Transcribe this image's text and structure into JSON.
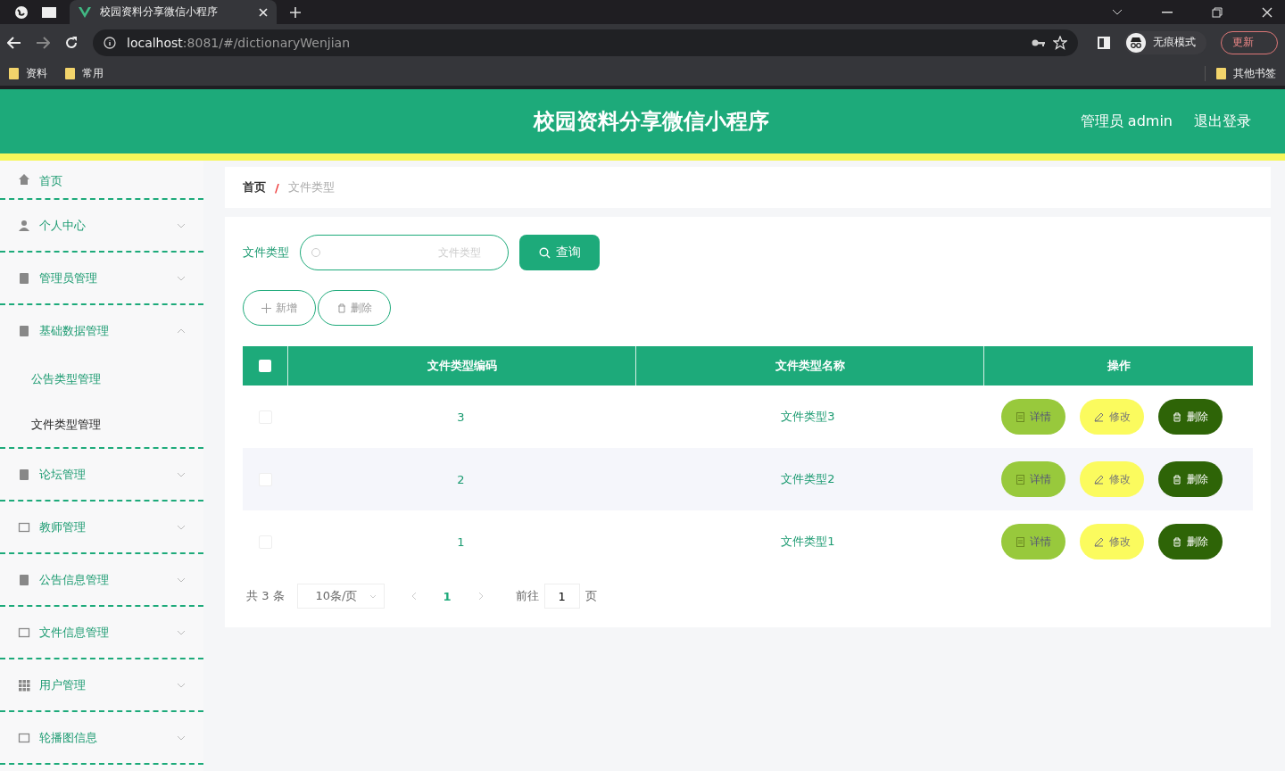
{
  "browser": {
    "tab_title": "校园资料分享微信小程序",
    "address_host": "localhost",
    "address_rest": ":8081/#/dictionaryWenjian",
    "incognito_label": "无痕模式",
    "update_label": "更新",
    "bookmarks": [
      "资料",
      "常用"
    ],
    "other_bookmarks": "其他书签"
  },
  "header": {
    "title": "校园资料分享微信小程序",
    "user": "管理员 admin",
    "logout": "退出登录"
  },
  "sidebar": {
    "items": [
      {
        "label": "首页",
        "has_arrow": false
      },
      {
        "label": "个人中心",
        "has_arrow": true,
        "expanded": false
      },
      {
        "label": "管理员管理",
        "has_arrow": true,
        "expanded": false
      },
      {
        "label": "基础数据管理",
        "has_arrow": true,
        "expanded": true,
        "children": [
          {
            "label": "公告类型管理",
            "selected": false
          },
          {
            "label": "文件类型管理",
            "selected": true
          }
        ]
      },
      {
        "label": "论坛管理",
        "has_arrow": true,
        "expanded": false
      },
      {
        "label": "教师管理",
        "has_arrow": true,
        "expanded": false
      },
      {
        "label": "公告信息管理",
        "has_arrow": true,
        "expanded": false
      },
      {
        "label": "文件信息管理",
        "has_arrow": true,
        "expanded": false
      },
      {
        "label": "用户管理",
        "has_arrow": true,
        "expanded": false
      },
      {
        "label": "轮播图信息",
        "has_arrow": true,
        "expanded": false
      }
    ]
  },
  "breadcrumb": [
    "首页",
    "文件类型"
  ],
  "breadcrumb_separator": "/",
  "search": {
    "label": "文件类型",
    "placeholder": "文件类型",
    "button": "查询"
  },
  "actions": [
    "新增",
    "删除"
  ],
  "table": {
    "select_all_checked": false,
    "columns": [
      "文件类型编码",
      "文件类型名称",
      "操作"
    ],
    "rows": [
      {
        "checked": false,
        "code": "3",
        "name": "文件类型3",
        "buttons": [
          "详情",
          "修改",
          "删除"
        ]
      },
      {
        "checked": false,
        "code": "2",
        "name": "文件类型2",
        "buttons": [
          "详情",
          "修改",
          "删除"
        ]
      },
      {
        "checked": false,
        "code": "1",
        "name": "文件类型1",
        "buttons": [
          "详情",
          "修改",
          "删除"
        ]
      }
    ]
  },
  "pagination": {
    "total": "共 3 条",
    "page_size": "10条/页",
    "pages": [
      {
        "label": "1",
        "selected": true
      }
    ],
    "goto_label": "前往",
    "goto_value": "1",
    "page_suffix": "页"
  }
}
